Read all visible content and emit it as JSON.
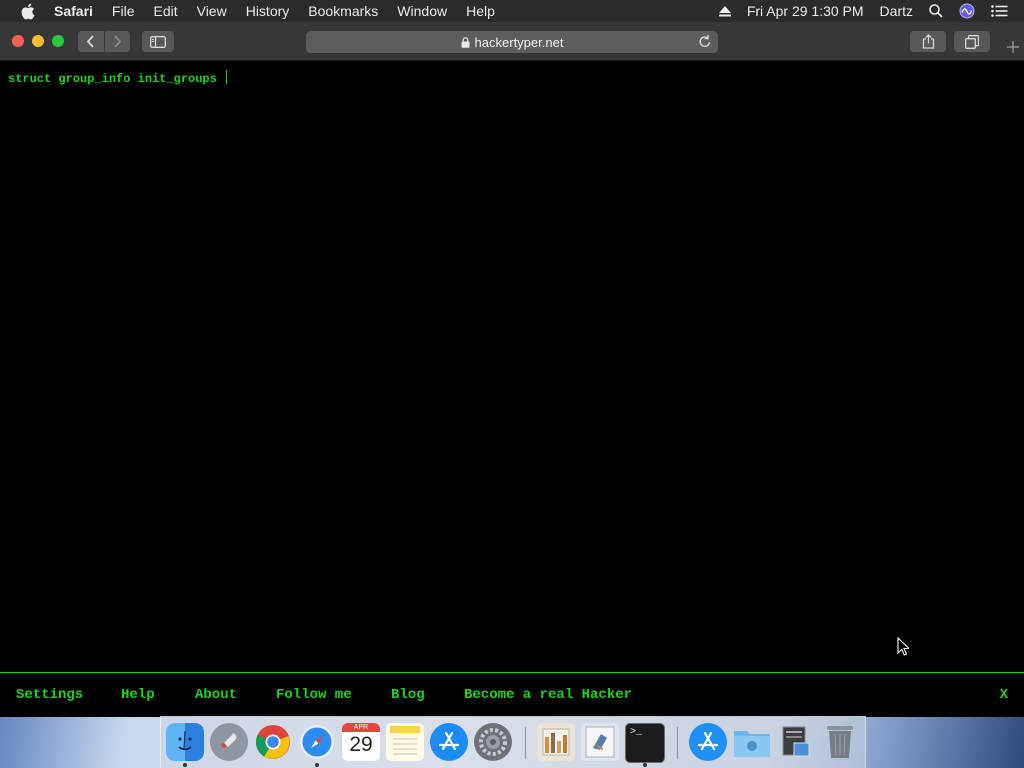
{
  "menubar": {
    "app_name": "Safari",
    "items": [
      "File",
      "Edit",
      "View",
      "History",
      "Bookmarks",
      "Window",
      "Help"
    ],
    "clock": "Fri Apr 29  1:30 PM",
    "user": "Dartz"
  },
  "browser": {
    "url": "hackertyper.net"
  },
  "console": {
    "text": "struct group_info init_groups "
  },
  "footer": {
    "links": [
      "Settings",
      "Help",
      "About",
      "Follow me",
      "Blog",
      "Become a real Hacker"
    ],
    "close_label": "X"
  },
  "dock": {
    "calendar_month": "APR",
    "calendar_day": "29",
    "terminal_prompt": ">_"
  },
  "colors": {
    "terminal_green": "#1fd21f",
    "page_background": "#000000"
  }
}
